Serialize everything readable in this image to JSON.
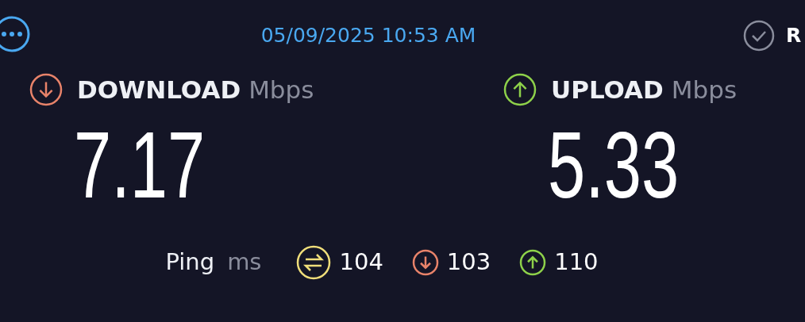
{
  "header": {
    "timestamp": "05/09/2025 10:53 AM",
    "result_label": "R"
  },
  "metrics": [
    {
      "kind": "download",
      "name": "DOWNLOAD",
      "unit": "Mbps",
      "value": "7.17",
      "color": "#e8836a"
    },
    {
      "kind": "upload",
      "name": "UPLOAD",
      "unit": "Mbps",
      "value": "5.33",
      "color": "#8ed14a"
    }
  ],
  "ping": {
    "label": "Ping",
    "unit": "ms",
    "readings": [
      {
        "kind": "jitter",
        "value": "104",
        "color": "#f0de7a"
      },
      {
        "kind": "download",
        "value": "103",
        "color": "#e8836a"
      },
      {
        "kind": "upload",
        "value": "110",
        "color": "#8ed14a"
      }
    ]
  }
}
